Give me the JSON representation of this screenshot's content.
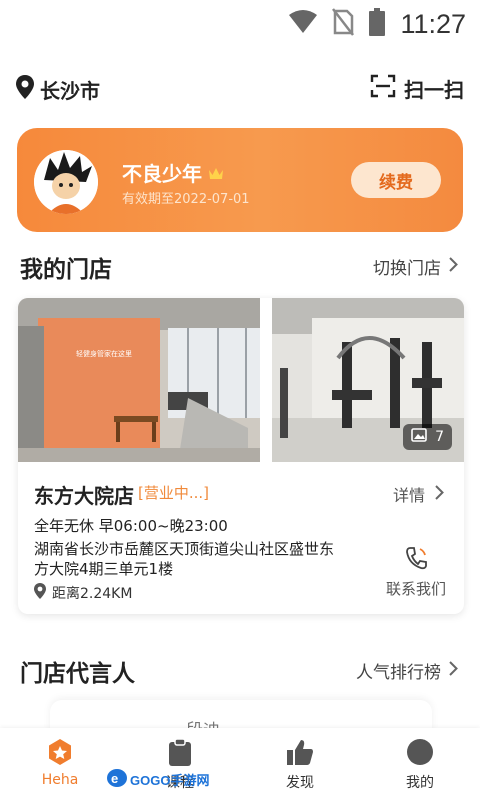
{
  "status_bar": {
    "time": "11:27"
  },
  "topbar": {
    "city": "长沙市",
    "scan_label": "扫一扫"
  },
  "member": {
    "name": "不良少年",
    "valid_until": "有效期至2022-07-01",
    "renew_label": "续费"
  },
  "my_store": {
    "title": "我的门店",
    "switch_label": "切换门店"
  },
  "store": {
    "photo_count": "7",
    "name": "东方大院店",
    "status": "[营业中...]",
    "detail_label": "详情",
    "hours": "全年无休 早06:00~晚23:00",
    "address": "湖南省长沙市岳麓区天顶街道尖山社区盛世东方大院4期三单元1楼",
    "distance": "距离2.24KM",
    "contact_label": "联系我们",
    "poster_text": "轻健身管家在这里"
  },
  "ambassador": {
    "title": "门店代言人",
    "ranking_label": "人气排行榜",
    "peek_text": "段迪"
  },
  "tabbar": {
    "items": [
      {
        "label": "Heha",
        "icon": "heha-home-icon",
        "active": true
      },
      {
        "label": "课程",
        "icon": "clipboard-icon",
        "active": false
      },
      {
        "label": "发现",
        "icon": "thumbs-up-icon",
        "active": false
      },
      {
        "label": "我的",
        "icon": "profile-icon",
        "active": false
      }
    ]
  },
  "watermark": {
    "text": "GOGO手游网"
  },
  "colors": {
    "accent": "#f07d2e",
    "card_gradient_start": "#f6893b",
    "renew_bg": "#fde6cf"
  }
}
